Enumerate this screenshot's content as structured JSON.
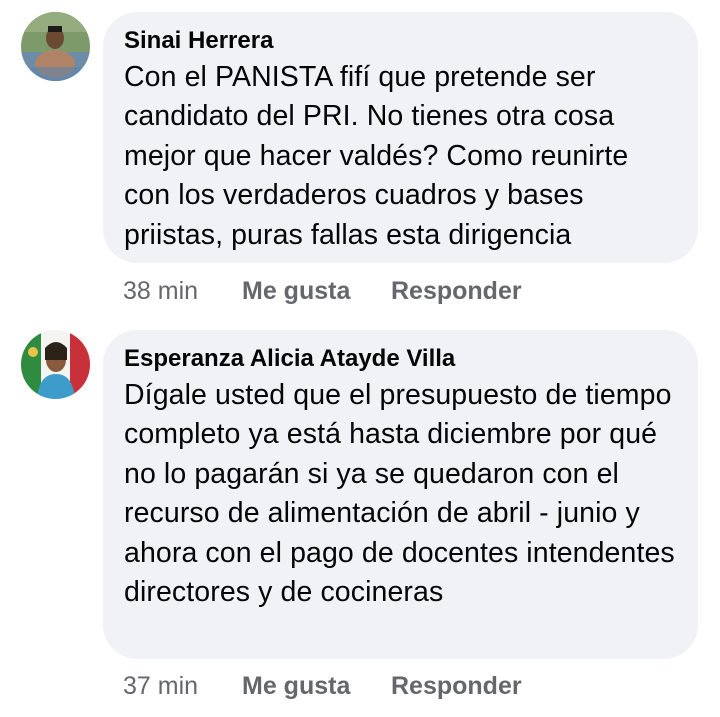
{
  "comments": [
    {
      "author": "Sinai Herrera",
      "text": "Con el PANISTA fifí que pretende ser candidato del PRI. No tienes otra cosa mejor que hacer valdés? Como reunirte con los verdaderos cuadros y bases priistas, puras fallas esta dirigencia",
      "time": "38 min",
      "like_label": "Me gusta",
      "reply_label": "Responder"
    },
    {
      "author": "Esperanza Alicia Atayde Villa",
      "text": "Dígale usted que el presupuesto de tiempo completo ya está hasta diciembre por qué no lo pagarán si ya se quedaron con el recurso de alimentación de abril - junio y ahora con el pago de docentes intendentes directores y de cocineras",
      "time": "37 min",
      "like_label": "Me gusta",
      "reply_label": "Responder"
    }
  ],
  "colors": {
    "bubble": "#f0f2f5",
    "text": "#050505",
    "meta": "#65676b"
  }
}
